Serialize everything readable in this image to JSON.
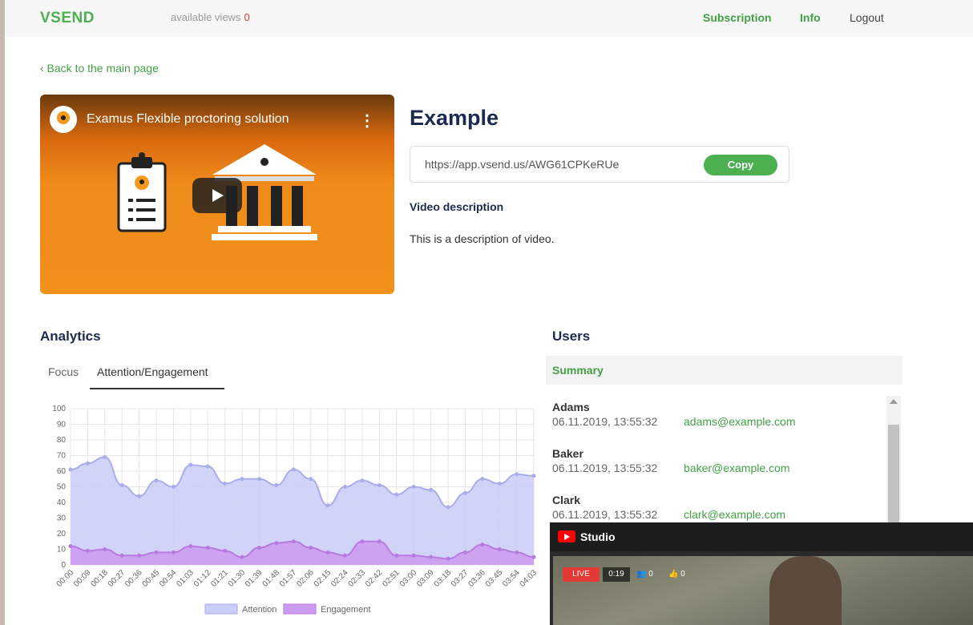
{
  "header": {
    "logo": "VSEND",
    "views_label": "available views",
    "views_count": "0",
    "nav": {
      "subscription": "Subscription",
      "info": "Info",
      "logout": "Logout"
    }
  },
  "back_link": "‹ Back to the main page",
  "video": {
    "title": "Examus Flexible proctoring solution",
    "menu_icon": "more-vert-icon"
  },
  "details": {
    "title": "Example",
    "url": "https://app.vsend.us/AWG61CPKeRUe",
    "copy_label": "Copy",
    "description_heading": "Video description",
    "description": "This is a description of video."
  },
  "analytics": {
    "heading": "Analytics",
    "tabs": [
      "Focus",
      "Attention/Engagement"
    ],
    "active_tab": "Attention/Engagement"
  },
  "chart_data": {
    "type": "area",
    "x": [
      "00:00",
      "00:09",
      "00:18",
      "00:27",
      "00:36",
      "00:45",
      "00:54",
      "01:03",
      "01:12",
      "01:21",
      "01:30",
      "01:39",
      "01:48",
      "01:57",
      "02:06",
      "02:15",
      "02:24",
      "02:33",
      "02:42",
      "02:51",
      "03:00",
      "03:09",
      "03:18",
      "03:27",
      "03:36",
      "03:45",
      "03:54",
      "04:03"
    ],
    "ylim": [
      0,
      100
    ],
    "yticks": [
      0,
      10,
      20,
      30,
      40,
      50,
      60,
      70,
      80,
      90,
      100
    ],
    "grid": true,
    "legend": "bottom",
    "series": [
      {
        "name": "Attention",
        "color": "#c9cdf7",
        "stroke": "#a9aeeb",
        "values": [
          61,
          65,
          69,
          51,
          44,
          54,
          50,
          64,
          63,
          52,
          55,
          55,
          51,
          61,
          55,
          38,
          50,
          54,
          51,
          45,
          50,
          48,
          37,
          46,
          55,
          52,
          58,
          57
        ]
      },
      {
        "name": "Engagement",
        "color": "#cc9af0",
        "stroke": "#b77ae0",
        "values": [
          12,
          9,
          10,
          6,
          6,
          8,
          8,
          12,
          11,
          9,
          5,
          11,
          14,
          15,
          11,
          8,
          6,
          15,
          15,
          6,
          6,
          5,
          4,
          8,
          13,
          10,
          8,
          5
        ]
      }
    ]
  },
  "users": {
    "heading": "Users",
    "summary_label": "Summary",
    "list": [
      {
        "name": "Adams",
        "date": "06.11.2019, 13:55:32",
        "email": "adams@example.com"
      },
      {
        "name": "Baker",
        "date": "06.11.2019, 13:55:32",
        "email": "baker@example.com"
      },
      {
        "name": "Clark",
        "date": "06.11.2019, 13:55:32",
        "email": "clark@example.com"
      }
    ]
  },
  "studio": {
    "title": "Studio",
    "live_label": "LIVE",
    "time": "0:19",
    "viewers": "0",
    "likes": "0"
  }
}
